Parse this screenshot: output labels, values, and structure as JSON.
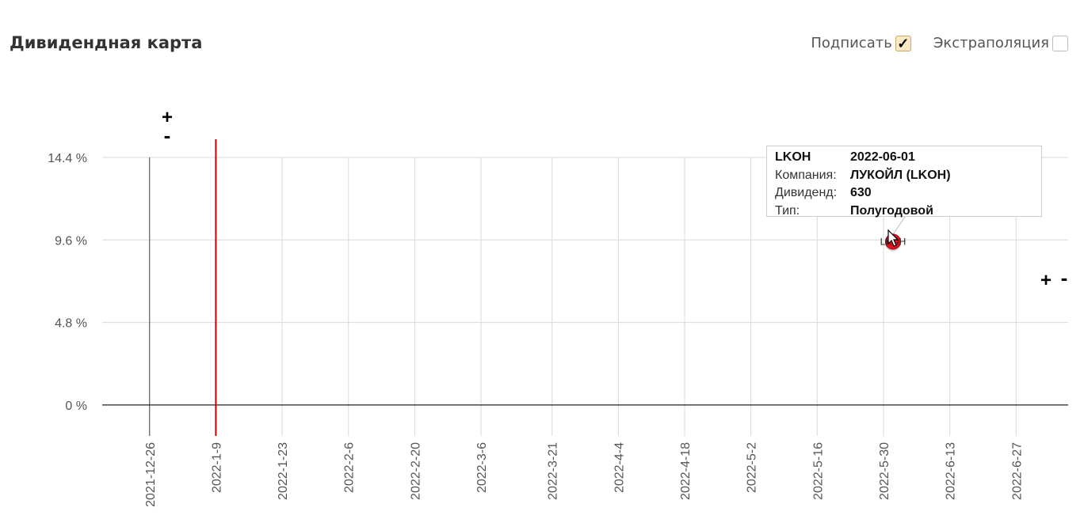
{
  "header": {
    "title": "Дивидендная карта"
  },
  "controls": {
    "label_toggle": {
      "label": "Подписать",
      "checked": true,
      "mark": "✓"
    },
    "extrapolation_toggle": {
      "label": "Экстраполяция",
      "checked": false
    }
  },
  "zoom": {
    "plus": "+",
    "minus": "-"
  },
  "tooltip": {
    "ticker": "LKOH",
    "date": "2022-06-01",
    "company_label": "Компания:",
    "company": "ЛУКОЙЛ (LKOH)",
    "dividend_label": "Дивиденд:",
    "dividend": "630",
    "type_label": "Тип:",
    "type": "Полугодовой"
  },
  "chart_data": {
    "type": "scatter",
    "x_tick_labels": [
      "2021-12-26",
      "2022-1-9",
      "2022-1-23",
      "2022-2-6",
      "2022-2-20",
      "2022-3-6",
      "2022-3-21",
      "2022-4-4",
      "2022-4-18",
      "2022-5-2",
      "2022-5-16",
      "2022-5-30",
      "2022-6-13",
      "2022-6-27"
    ],
    "y_ticks": [
      0,
      4.8,
      9.6,
      14.4
    ],
    "y_tick_labels": [
      "0 %",
      "4.8 %",
      "9.6 %",
      "14.4 %"
    ],
    "ylim": [
      -1.8,
      14.4
    ],
    "xlim": [
      "2021-12-16",
      "2022-07-08"
    ],
    "grid": true,
    "today_marker": "2022-01-09",
    "points": [
      {
        "label": "LKOH",
        "x": "2022-06-01",
        "y": 9.5,
        "color": "#e0141e"
      }
    ],
    "colors": {
      "today_line": "#cc0000",
      "grid": "#d9d9d9",
      "axis": "#444444"
    }
  }
}
